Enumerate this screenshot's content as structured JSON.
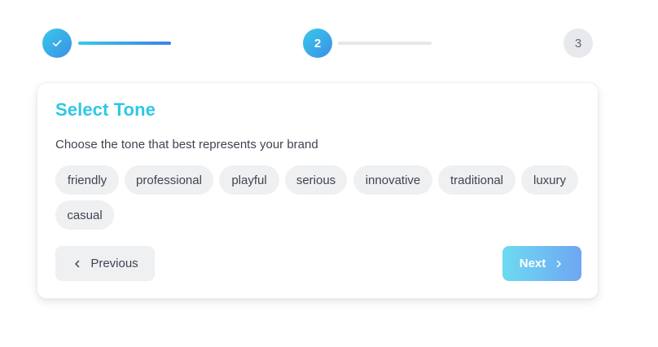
{
  "stepper": {
    "steps": [
      {
        "label": "",
        "state": "completed",
        "icon": "check-icon"
      },
      {
        "label": "2",
        "state": "active"
      },
      {
        "label": "3",
        "state": "pending"
      }
    ],
    "progress": [
      1,
      0
    ]
  },
  "card": {
    "title": "Select Tone",
    "subtitle": "Choose the tone that best represents your brand",
    "tones": [
      "friendly",
      "professional",
      "playful",
      "serious",
      "innovative",
      "traditional",
      "luxury",
      "casual"
    ]
  },
  "buttons": {
    "previous_label": "Previous",
    "previous_icon": "chevron-left-icon",
    "next_label": "Next",
    "next_icon": "chevron-right-icon"
  },
  "colors": {
    "accent": "#2ec8e6",
    "accent_blue": "#3b82e6",
    "chip_bg": "#eff0f2",
    "text": "#3f4450"
  }
}
